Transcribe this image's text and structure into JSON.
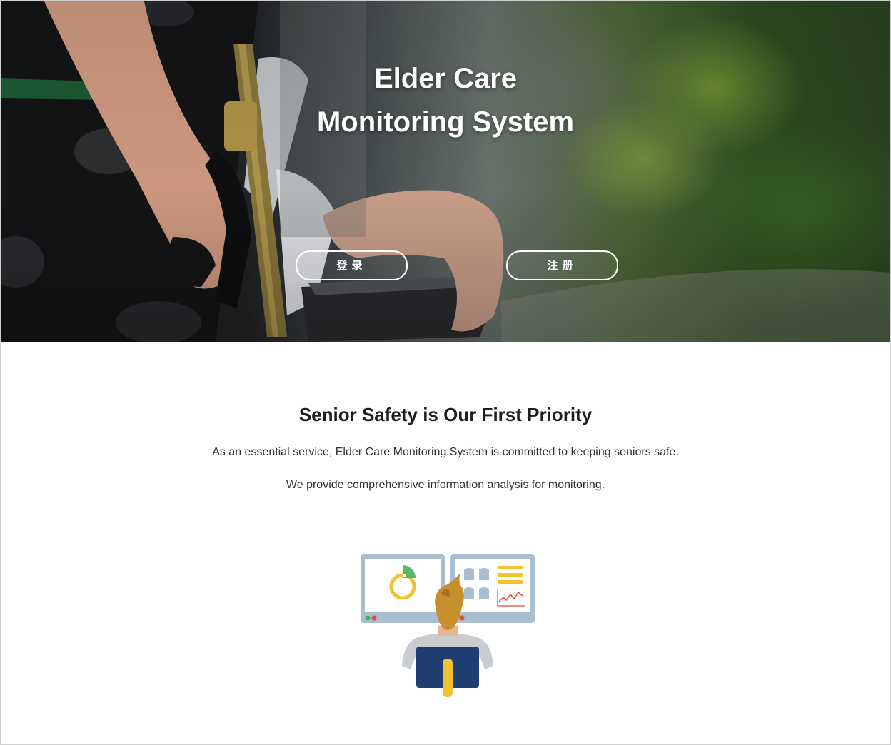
{
  "hero": {
    "title_line1": "Elder Care",
    "title_line2": "Monitoring System",
    "login_label": "登录",
    "register_label": "注册"
  },
  "intro": {
    "heading": "Senior Safety is Our First Priority",
    "line1": "As an essential service, Elder Care Monitoring System is committed to keeping seniors safe.",
    "line2": "We provide comprehensive information analysis for monitoring."
  },
  "illustration": {
    "subject": "person-monitoring-dashboards",
    "colors": {
      "navy": "#1f3f73",
      "yellow": "#f2c230",
      "green": "#58b868",
      "monitor_frame": "#a9bfcf",
      "hair": "#c7902f"
    }
  }
}
